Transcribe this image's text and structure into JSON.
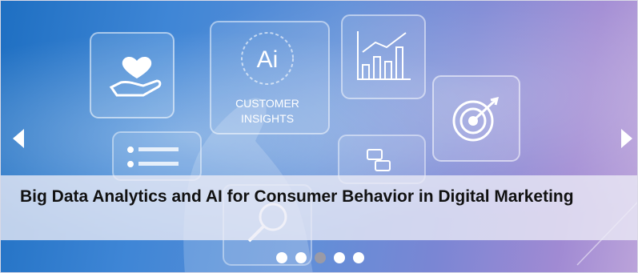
{
  "slider": {
    "caption": "Big Data Analytics and AI for Consumer Behavior in Digital Marketing",
    "image_texts": {
      "ai": "Ai",
      "line1": "CUSTOMER",
      "line2": "INSIGHTS"
    },
    "slides_count": 5,
    "active_slide": 3,
    "prev_icon": "triangle-left-icon",
    "next_icon": "triangle-right-icon"
  }
}
